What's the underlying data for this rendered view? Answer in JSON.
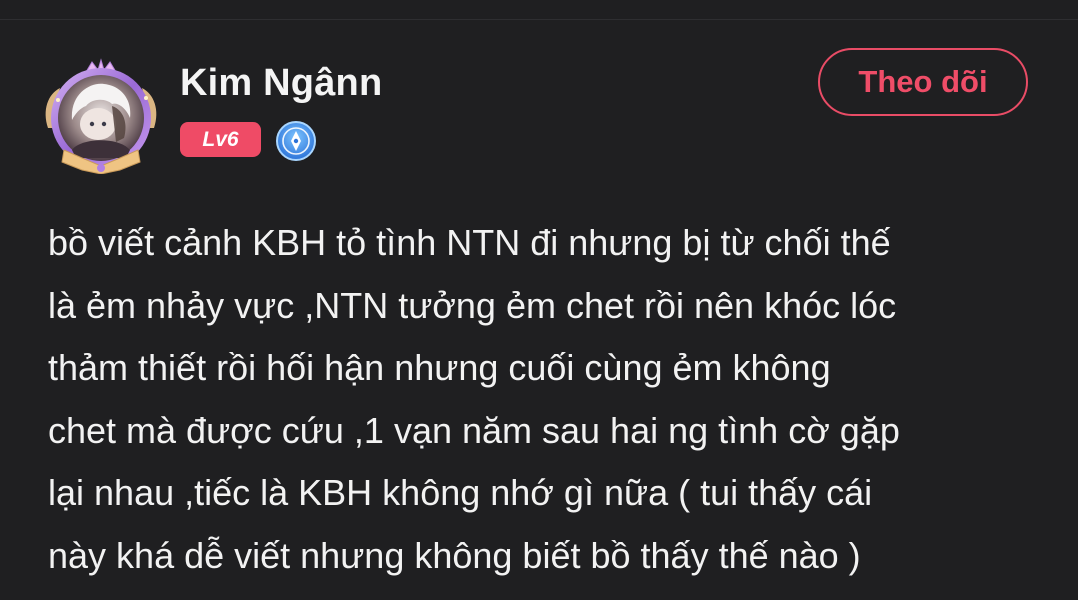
{
  "user": {
    "name": "Kim Ngânn",
    "level": "Lv6",
    "avatar_icon": "anime-avatar-with-purple-frame",
    "verified_icon": "blue-pen-badge-icon"
  },
  "actions": {
    "follow_label": "Theo dõi"
  },
  "post": {
    "lines": [
      "bồ viết cảnh KBH tỏ tình NTN đi nhưng bị từ chối thế",
      "là ẻm nhảy vực ,NTN tưởng ẻm chet rồi nên khóc lóc",
      "thảm thiết rồi hối hận nhưng cuối cùng ẻm không",
      "chet mà được cứu ,1 vạn năm sau hai ng tình cờ gặp",
      "lại nhau ,tiếc là KBH không nhớ gì nữa ( tui thấy cái",
      "này khá dễ viết nhưng không biết bồ thấy thế nào )"
    ]
  },
  "colors": {
    "background": "#1f1f21",
    "accent": "#ef4b66",
    "text": "#f2f2f2",
    "badge_blue": "#3d8ff0"
  }
}
